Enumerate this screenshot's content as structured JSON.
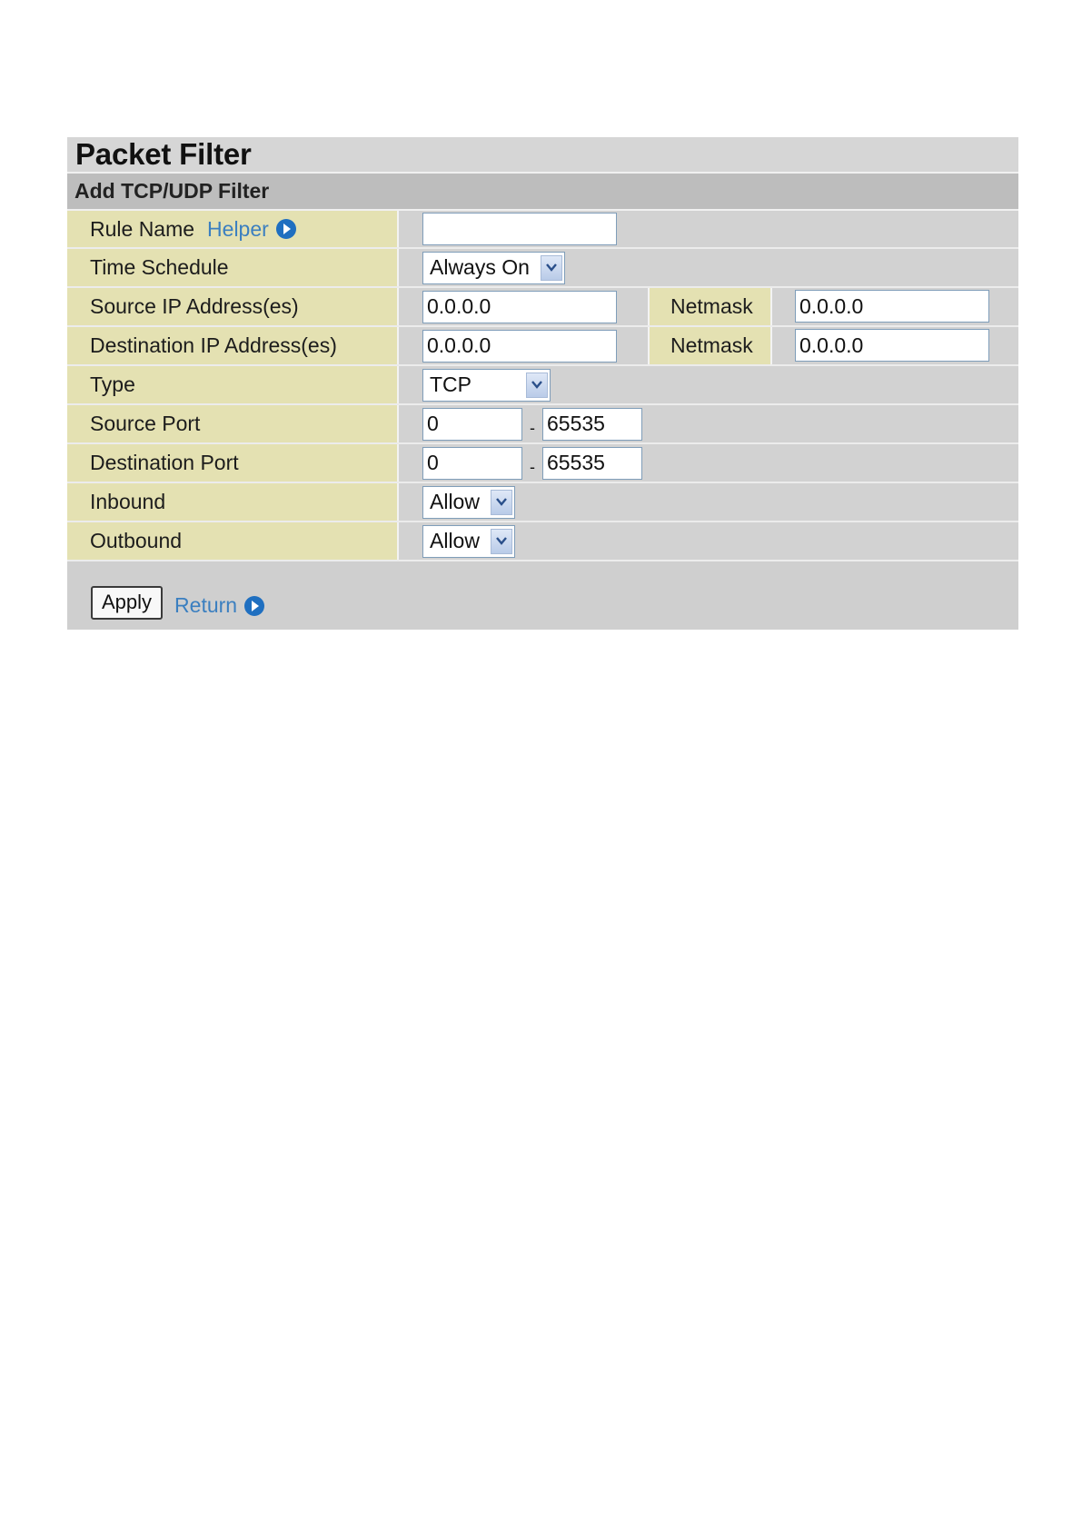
{
  "page_title": "Packet Filter",
  "section_title": "Add TCP/UDP Filter",
  "rule_name": {
    "label": "Rule Name",
    "helper_link": "Helper",
    "value": ""
  },
  "time_schedule": {
    "label": "Time Schedule",
    "selected": "Always On"
  },
  "source_ip": {
    "label": "Source IP Address(es)",
    "value": "0.0.0.0",
    "netmask_label": "Netmask",
    "netmask_value": "0.0.0.0"
  },
  "dest_ip": {
    "label": "Destination IP Address(es)",
    "value": "0.0.0.0",
    "netmask_label": "Netmask",
    "netmask_value": "0.0.0.0"
  },
  "type": {
    "label": "Type",
    "selected": "TCP"
  },
  "source_port": {
    "label": "Source Port",
    "from": "0",
    "separator": "-",
    "to": "65535"
  },
  "dest_port": {
    "label": "Destination Port",
    "from": "0",
    "separator": "-",
    "to": "65535"
  },
  "inbound": {
    "label": "Inbound",
    "selected": "Allow"
  },
  "outbound": {
    "label": "Outbound",
    "selected": "Allow"
  },
  "footer": {
    "apply_label": "Apply",
    "return_label": "Return"
  },
  "icons": {
    "helper": "arrow-circle-icon",
    "return": "arrow-circle-icon",
    "dropdown": "chevron-down-icon"
  },
  "colors": {
    "label_bg": "#e4e1b2",
    "panel_bg": "#d2d2d2",
    "link": "#3b7fc0",
    "icon": "#1f6fc0"
  }
}
